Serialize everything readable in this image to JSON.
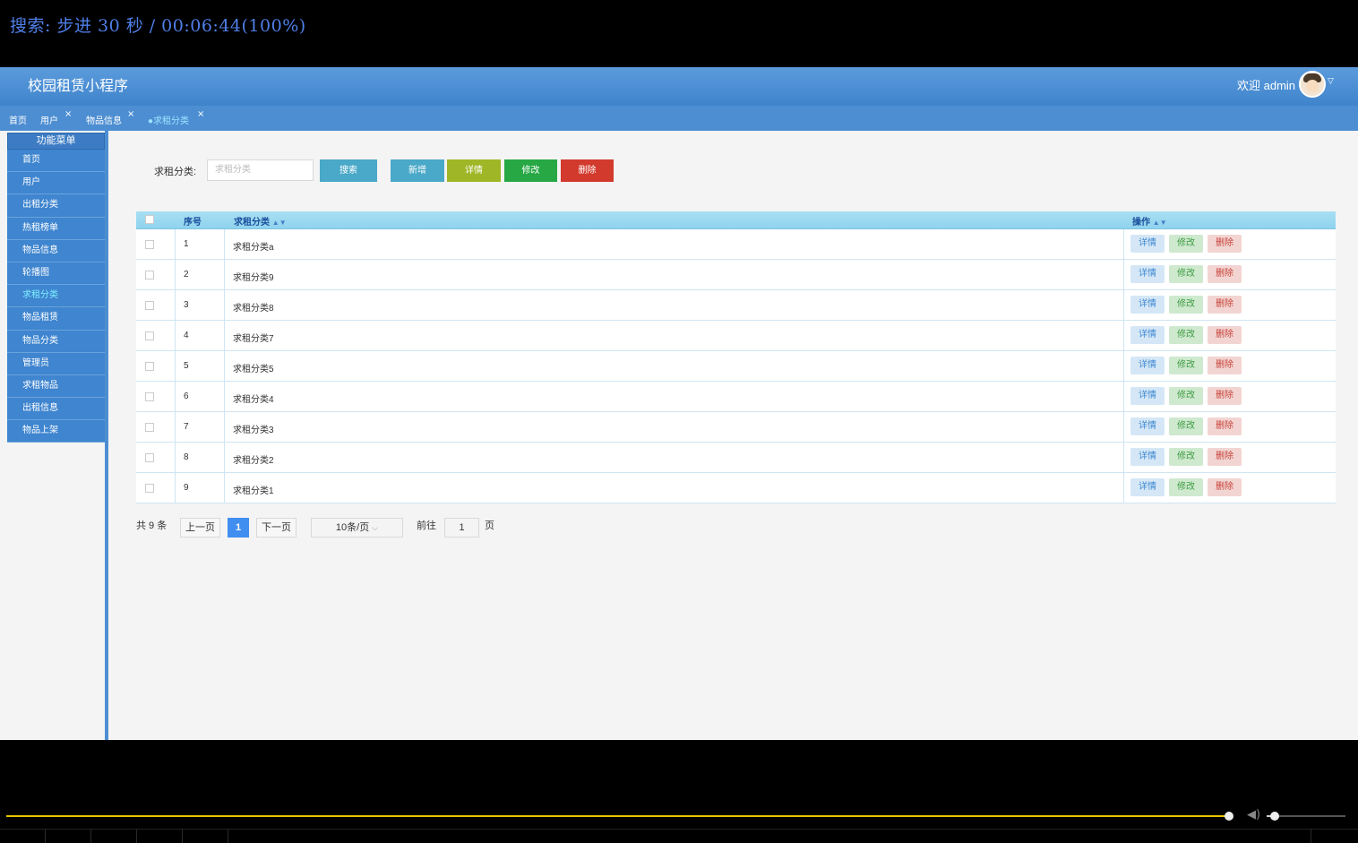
{
  "osd": {
    "text": "搜索: 步进 30 秒 / 00:06:44(100%)"
  },
  "header": {
    "app_title": "校园租赁小程序",
    "welcome": "欢迎 admin"
  },
  "tabs": [
    {
      "label": "首页",
      "closable": false,
      "active": false
    },
    {
      "label": "用户",
      "closable": true,
      "active": false
    },
    {
      "label": "物品信息",
      "closable": true,
      "active": false
    },
    {
      "label": "●求租分类",
      "closable": true,
      "active": true
    }
  ],
  "sidebar": {
    "title": "功能菜单",
    "items": [
      "首页",
      "用户",
      "出租分类",
      "热租榜单",
      "物品信息",
      "轮播图",
      "求租分类",
      "物品租赁",
      "物品分类",
      "管理员",
      "求租物品",
      "出租信息",
      "物品上架"
    ],
    "active_index": 6
  },
  "search": {
    "label": "求租分类:",
    "placeholder": "求租分类"
  },
  "toolbar": {
    "search_label": "搜索",
    "add_label": "新增",
    "detail_label": "详情",
    "edit_label": "修改",
    "delete_label": "删除"
  },
  "table": {
    "headers": {
      "index": "序号",
      "category": "求租分类",
      "actions": "操作"
    },
    "rows": [
      {
        "index": "1",
        "category": "求租分类a"
      },
      {
        "index": "2",
        "category": "求租分类9"
      },
      {
        "index": "3",
        "category": "求租分类8"
      },
      {
        "index": "4",
        "category": "求租分类7"
      },
      {
        "index": "5",
        "category": "求租分类5"
      },
      {
        "index": "6",
        "category": "求租分类4"
      },
      {
        "index": "7",
        "category": "求租分类3"
      },
      {
        "index": "8",
        "category": "求租分类2"
      },
      {
        "index": "9",
        "category": "求租分类1"
      }
    ],
    "row_actions": {
      "detail": "详情",
      "edit": "修改",
      "delete": "删除"
    }
  },
  "pagination": {
    "total": "共 9 条",
    "prev": "上一页",
    "current": "1",
    "next": "下一页",
    "page_size": "10条/页",
    "goto_label": "前往",
    "goto_value": "1",
    "goto_suffix": "页"
  },
  "player": {
    "progress": 0.999,
    "volume": 0.1
  },
  "colors": {
    "topbar": "#4a8fd6",
    "accent": "#3f8ef0",
    "progress": "#e5c700"
  }
}
